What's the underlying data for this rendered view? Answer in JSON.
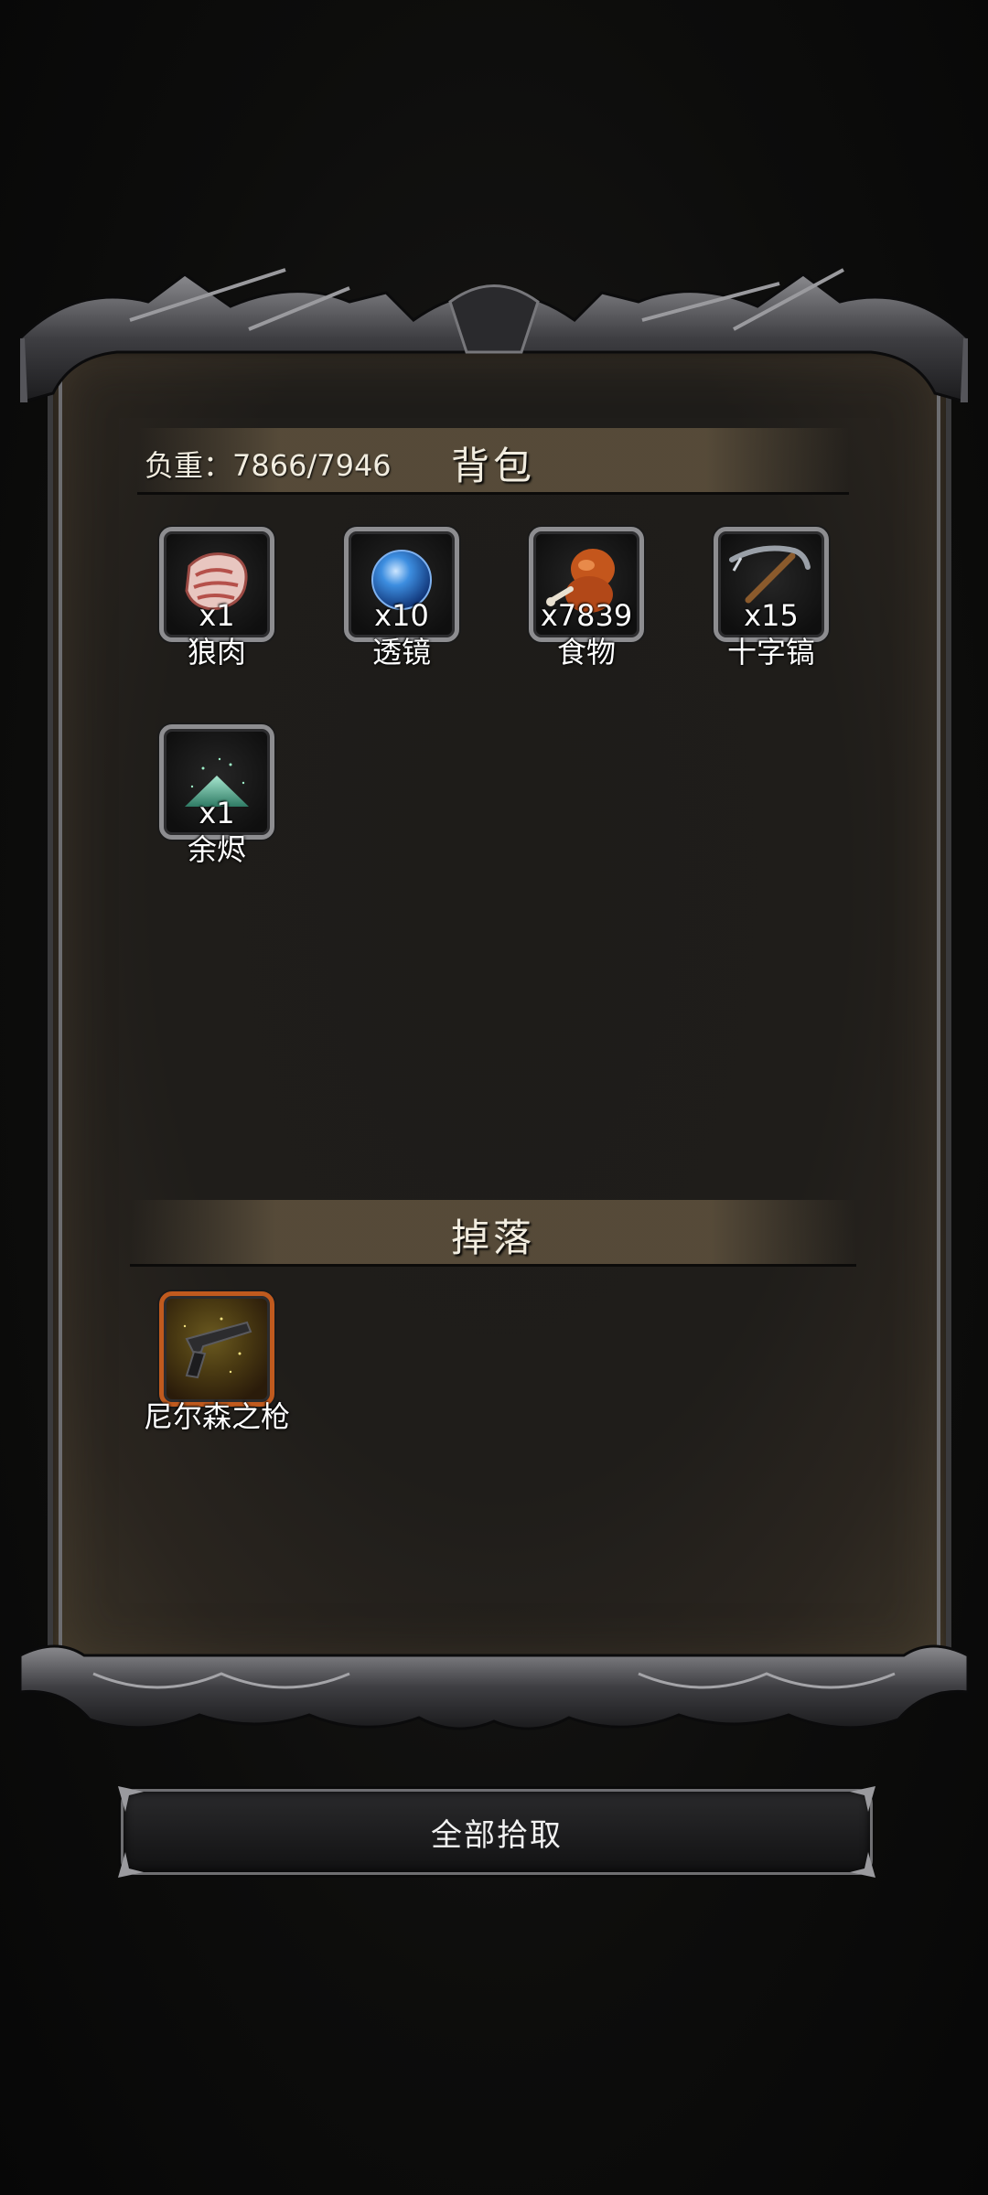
{
  "backpack": {
    "title": "背包",
    "weight_label": "负重：7866/7946",
    "items": [
      {
        "name": "狼肉",
        "qty": "x1",
        "icon": "meat-icon"
      },
      {
        "name": "透镜",
        "qty": "x10",
        "icon": "lens-icon"
      },
      {
        "name": "食物",
        "qty": "x7839",
        "icon": "food-drumstick-icon"
      },
      {
        "name": "十字镐",
        "qty": "x15",
        "icon": "pickaxe-icon"
      },
      {
        "name": "余烬",
        "qty": "x1",
        "icon": "ember-icon"
      }
    ]
  },
  "drops": {
    "title": "掉落",
    "items": [
      {
        "name": "尼尔森之枪",
        "icon": "gun-icon"
      }
    ]
  },
  "actions": {
    "pickup_all_label": "全部拾取"
  }
}
